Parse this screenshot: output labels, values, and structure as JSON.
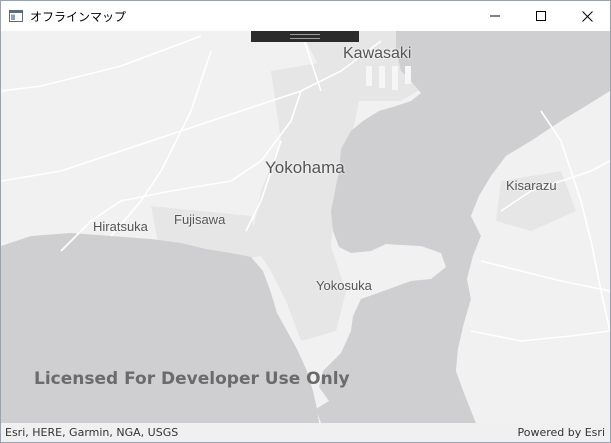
{
  "window": {
    "title": "オフラインマップ",
    "icons": {
      "app": "app-window-icon",
      "minimize": "minimize-icon",
      "maximize": "maximize-icon",
      "close": "close-icon"
    }
  },
  "map": {
    "labels": {
      "kawasaki": "Kawasaki",
      "yokohama": "Yokohama",
      "kisarazu": "Kisarazu",
      "hiratsuka": "Hiratsuka",
      "fujisawa": "Fujisawa",
      "yokosuka": "Yokosuka"
    },
    "watermark": "Licensed For Developer Use Only",
    "colors": {
      "land": "#f1f1f1",
      "water": "#cfcfd2",
      "urban": "#e5e5e5",
      "road": "#ffffff"
    }
  },
  "attribution": {
    "sources": "Esri, HERE, Garmin, NGA, USGS",
    "powered_by": "Powered by Esri"
  }
}
